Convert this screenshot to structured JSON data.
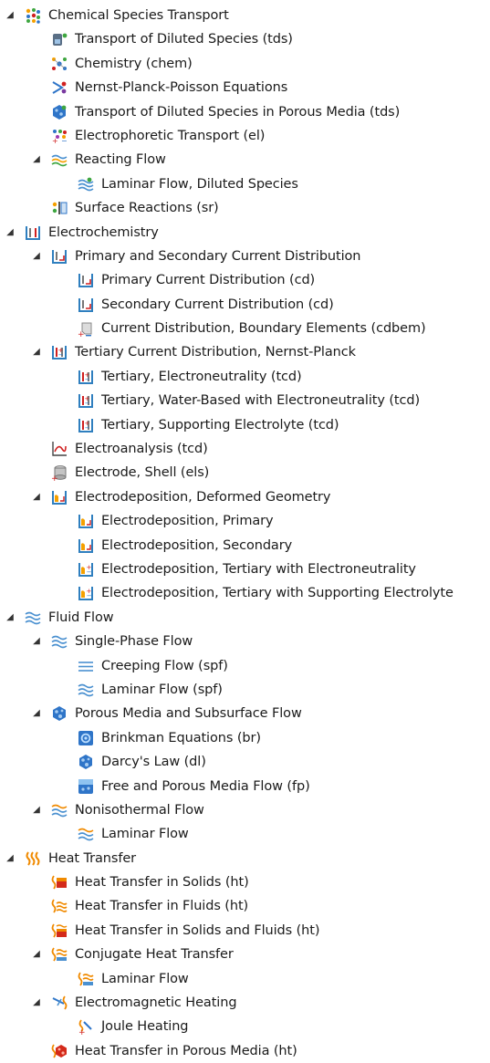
{
  "tree": {
    "nodes": [
      {
        "label": "Chemical Species Transport",
        "level": 0,
        "expanded": true,
        "icon": "chemical-species-icon"
      },
      {
        "label": "Transport of Diluted Species (tds)",
        "level": 1,
        "icon": "diluted-species-icon"
      },
      {
        "label": "Chemistry (chem)",
        "level": 1,
        "icon": "chemistry-icon"
      },
      {
        "label": "Nernst-Planck-Poisson Equations",
        "level": 1,
        "icon": "nernst-planck-icon"
      },
      {
        "label": "Transport of Diluted Species in Porous Media (tds)",
        "level": 1,
        "icon": "porous-species-icon"
      },
      {
        "label": "Electrophoretic Transport (el)",
        "level": 1,
        "icon": "electrophoretic-icon"
      },
      {
        "label": "Reacting Flow",
        "level": 1,
        "expanded": true,
        "icon": "reacting-flow-icon"
      },
      {
        "label": "Laminar Flow, Diluted Species",
        "level": 2,
        "icon": "reacting-laminar-icon"
      },
      {
        "label": "Surface Reactions (sr)",
        "level": 1,
        "icon": "surface-reactions-icon"
      },
      {
        "label": "Electrochemistry",
        "level": 0,
        "expanded": true,
        "icon": "electrochemistry-icon"
      },
      {
        "label": "Primary and Secondary Current Distribution",
        "level": 1,
        "expanded": true,
        "icon": "current-distribution-icon"
      },
      {
        "label": "Primary Current Distribution (cd)",
        "level": 2,
        "icon": "current-distribution-icon"
      },
      {
        "label": "Secondary Current Distribution (cd)",
        "level": 2,
        "icon": "current-distribution-icon"
      },
      {
        "label": "Current Distribution, Boundary Elements (cdbem)",
        "level": 2,
        "icon": "boundary-elements-icon"
      },
      {
        "label": "Tertiary Current Distribution, Nernst-Planck",
        "level": 1,
        "expanded": true,
        "icon": "tertiary-current-icon"
      },
      {
        "label": "Tertiary, Electroneutrality (tcd)",
        "level": 2,
        "icon": "tertiary-current-icon"
      },
      {
        "label": "Tertiary, Water-Based with Electroneutrality (tcd)",
        "level": 2,
        "icon": "tertiary-current-icon"
      },
      {
        "label": "Tertiary, Supporting Electrolyte (tcd)",
        "level": 2,
        "icon": "tertiary-current-icon"
      },
      {
        "label": "Electroanalysis (tcd)",
        "level": 1,
        "icon": "electroanalysis-icon"
      },
      {
        "label": "Electrode, Shell (els)",
        "level": 1,
        "icon": "electrode-shell-icon"
      },
      {
        "label": "Electrodeposition, Deformed Geometry",
        "level": 1,
        "expanded": true,
        "icon": "electrodeposition-icon"
      },
      {
        "label": "Electrodeposition, Primary",
        "level": 2,
        "icon": "electrodeposition-icon"
      },
      {
        "label": "Electrodeposition, Secondary",
        "level": 2,
        "icon": "electrodeposition-icon"
      },
      {
        "label": "Electrodeposition, Tertiary with Electroneutrality",
        "level": 2,
        "icon": "electrodeposition-tertiary-icon"
      },
      {
        "label": "Electrodeposition, Tertiary with Supporting Electrolyte",
        "level": 2,
        "icon": "electrodeposition-tertiary-icon"
      },
      {
        "label": "Fluid Flow",
        "level": 0,
        "expanded": true,
        "icon": "fluid-flow-icon"
      },
      {
        "label": "Single-Phase Flow",
        "level": 1,
        "expanded": true,
        "icon": "fluid-flow-icon"
      },
      {
        "label": "Creeping Flow (spf)",
        "level": 2,
        "icon": "creeping-flow-icon"
      },
      {
        "label": "Laminar Flow (spf)",
        "level": 2,
        "icon": "fluid-flow-icon"
      },
      {
        "label": "Porous Media and Subsurface Flow",
        "level": 1,
        "expanded": true,
        "icon": "porous-media-icon"
      },
      {
        "label": "Brinkman Equations (br)",
        "level": 2,
        "icon": "brinkman-icon"
      },
      {
        "label": "Darcy's Law (dl)",
        "level": 2,
        "icon": "porous-media-icon"
      },
      {
        "label": "Free and Porous Media Flow (fp)",
        "level": 2,
        "icon": "free-porous-flow-icon"
      },
      {
        "label": "Nonisothermal Flow",
        "level": 1,
        "expanded": true,
        "icon": "nonisothermal-flow-icon"
      },
      {
        "label": "Laminar Flow",
        "level": 2,
        "icon": "nonisothermal-flow-icon"
      },
      {
        "label": "Heat Transfer",
        "level": 0,
        "expanded": true,
        "icon": "heat-transfer-icon"
      },
      {
        "label": "Heat Transfer in Solids (ht)",
        "level": 1,
        "icon": "heat-solids-icon"
      },
      {
        "label": "Heat Transfer in Fluids (ht)",
        "level": 1,
        "icon": "heat-fluids-icon"
      },
      {
        "label": "Heat Transfer in Solids and Fluids (ht)",
        "level": 1,
        "icon": "heat-solids-fluids-icon"
      },
      {
        "label": "Conjugate Heat Transfer",
        "level": 1,
        "expanded": true,
        "icon": "conjugate-heat-icon"
      },
      {
        "label": "Laminar Flow",
        "level": 2,
        "icon": "conjugate-heat-icon"
      },
      {
        "label": "Electromagnetic Heating",
        "level": 1,
        "expanded": true,
        "icon": "em-heating-icon"
      },
      {
        "label": "Joule Heating",
        "level": 2,
        "icon": "joule-heating-icon"
      },
      {
        "label": "Heat Transfer in Porous Media (ht)",
        "level": 1,
        "icon": "heat-porous-icon"
      }
    ]
  },
  "colors": {
    "text": "#1a1a1a",
    "toggle": "#333333",
    "beaker": "#2f7fbf",
    "flow": "#4a90d0",
    "porous": "#2f75c8",
    "heat": "#f08a00",
    "heat_red": "#d42a1a",
    "red": "#d02020",
    "green": "#3ea640",
    "orange": "#f5a000"
  }
}
